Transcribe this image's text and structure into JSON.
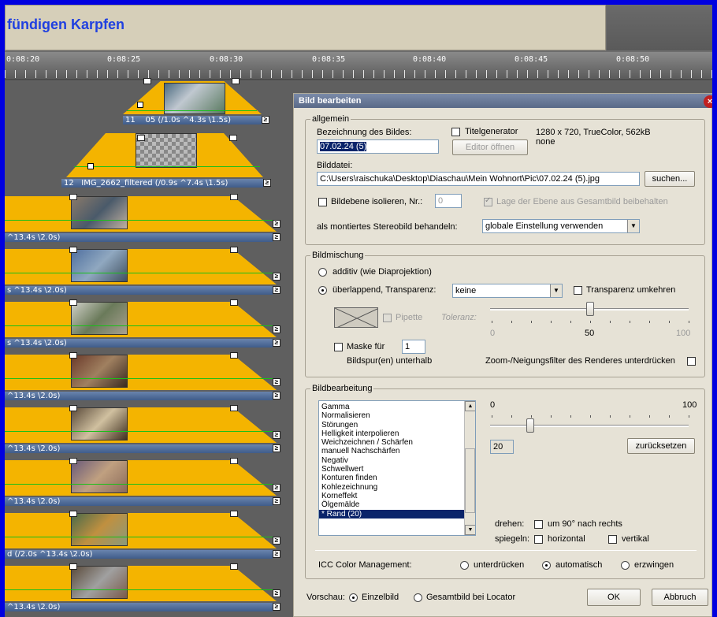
{
  "header": {
    "title": "fündigen Karpfen"
  },
  "ruler": {
    "labels": [
      "0:08:20",
      "0:08:25",
      "0:08:30",
      "0:08:35",
      "0:08:40",
      "0:08:45",
      "0:08:50"
    ]
  },
  "timeline": {
    "clips": [
      {
        "number": "11",
        "label": "05 (/1.0s ^4.3s \\1.5s)"
      },
      {
        "number": "12",
        "label": "IMG_2662_filtered (/0.9s ^7.4s \\1.5s)"
      },
      {
        "label": "^13.4s \\2.0s)"
      },
      {
        "label": "s ^13.4s \\2.0s)"
      },
      {
        "label": "s ^13.4s \\2.0s)"
      },
      {
        "label": "^13.4s \\2.0s)"
      },
      {
        "label": "^13.4s \\2.0s)"
      },
      {
        "label": "^13.4s \\2.0s)"
      },
      {
        "label": "d (/2.0s ^13.4s \\2.0s)"
      },
      {
        "label": "^13.4s \\2.0s)"
      }
    ]
  },
  "dialog": {
    "title": "Bild bearbeiten",
    "allgemein": {
      "legend": "allgemein",
      "bezeichnung_label": "Bezeichnung des Bildes:",
      "bezeichnung_value": "07.02.24 (5)",
      "titelgenerator_label": "Titelgenerator",
      "editor_button": "Editor öffnen",
      "info": "1280 x 720, TrueColor, 562kB",
      "info2": "none",
      "bilddatei_label": "Bilddatei:",
      "bilddatei_value": "C:\\Users\\raischuka\\Desktop\\Diaschau\\Mein Wohnort\\Pic\\07.02.24 (5).jpg",
      "suchen_button": "suchen...",
      "isolieren_label": "Bildebene isolieren, Nr.:",
      "isolieren_value": "0",
      "lage_label": "Lage der Ebene aus Gesamtbild beibehalten",
      "stereo_label": "als montiertes Stereobild behandeln:",
      "stereo_value": "globale Einstellung verwenden"
    },
    "bildmischung": {
      "legend": "Bildmischung",
      "additiv_label": "additiv (wie Diaprojektion)",
      "ueberlappend_label": "überlappend, Transparenz:",
      "transparenz_value": "keine",
      "umkehren_label": "Transparenz umkehren",
      "pipette_label": "Pipette",
      "toleranz_label": "Toleranz:",
      "slider_min": "0",
      "slider_mid": "50",
      "slider_max": "100",
      "slider_value": 50,
      "maske_label": "Maske für",
      "maske_value": "1",
      "bildspur_label": "Bildspur(en) unterhalb",
      "zoom_label": "Zoom-/Neigungsfilter des Renderes unterdrücken"
    },
    "bildbearbeitung": {
      "legend": "Bildbearbeitung",
      "effects": [
        "Gamma",
        "Normalisieren",
        "Störungen",
        "Helligkeit interpolieren",
        "Weichzeichnen / Schärfen",
        "manuell Nachschärfen",
        "Negativ",
        "Schwellwert",
        "Konturen finden",
        "Kohlezeichnung",
        "Korneffekt",
        "Ölgemälde",
        "* Rand (20)"
      ],
      "slider_min": "0",
      "slider_max": "100",
      "slider_value": 20,
      "value_box": "20",
      "zuruecksetzen_button": "zurücksetzen",
      "drehen_label": "drehen:",
      "drehen_option": "um 90° nach rechts",
      "spiegeln_label": "spiegeln:",
      "horizontal_label": "horizontal",
      "vertikal_label": "vertikal",
      "icc_label": "ICC Color Management:",
      "icc_options": [
        "unterdrücken",
        "automatisch",
        "erzwingen"
      ]
    },
    "footer": {
      "vorschau_label": "Vorschau:",
      "einzelbild_label": "Einzelbild",
      "gesamtbild_label": "Gesamtbild bei Locator",
      "ok_button": "OK",
      "abbruch_button": "Abbruch"
    }
  }
}
